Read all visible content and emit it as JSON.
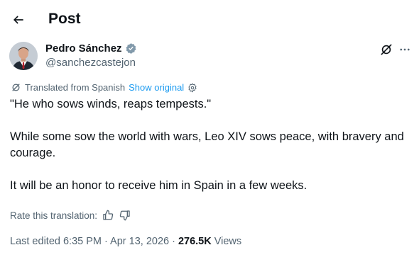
{
  "header": {
    "title": "Post"
  },
  "author": {
    "name": "Pedro Sánchez",
    "handle": "@sanchezcastejon"
  },
  "translation": {
    "label": "Translated from Spanish",
    "show_original": "Show original"
  },
  "tweet": {
    "paragraphs": [
      "\"He who sows winds, reaps tempests.\"",
      "While some sow the world with wars, Leo XIV sows peace, with bravery and courage.",
      "It will be an honor to receive him in Spain in a few weeks."
    ]
  },
  "rating": {
    "label": "Rate this translation:"
  },
  "meta": {
    "edited": "Last edited 6:35 PM · Apr 13, 2026",
    "separator": "·",
    "views_count": "276.5K",
    "views_label": "Views"
  },
  "colors": {
    "text": "#0f1419",
    "secondary": "#536471",
    "accent": "#1d9bf0"
  },
  "icons": [
    "back-arrow-icon",
    "verified-badge-icon",
    "grok-icon",
    "more-icon",
    "translate-icon",
    "gear-icon",
    "thumbs-up-icon",
    "thumbs-down-icon"
  ]
}
